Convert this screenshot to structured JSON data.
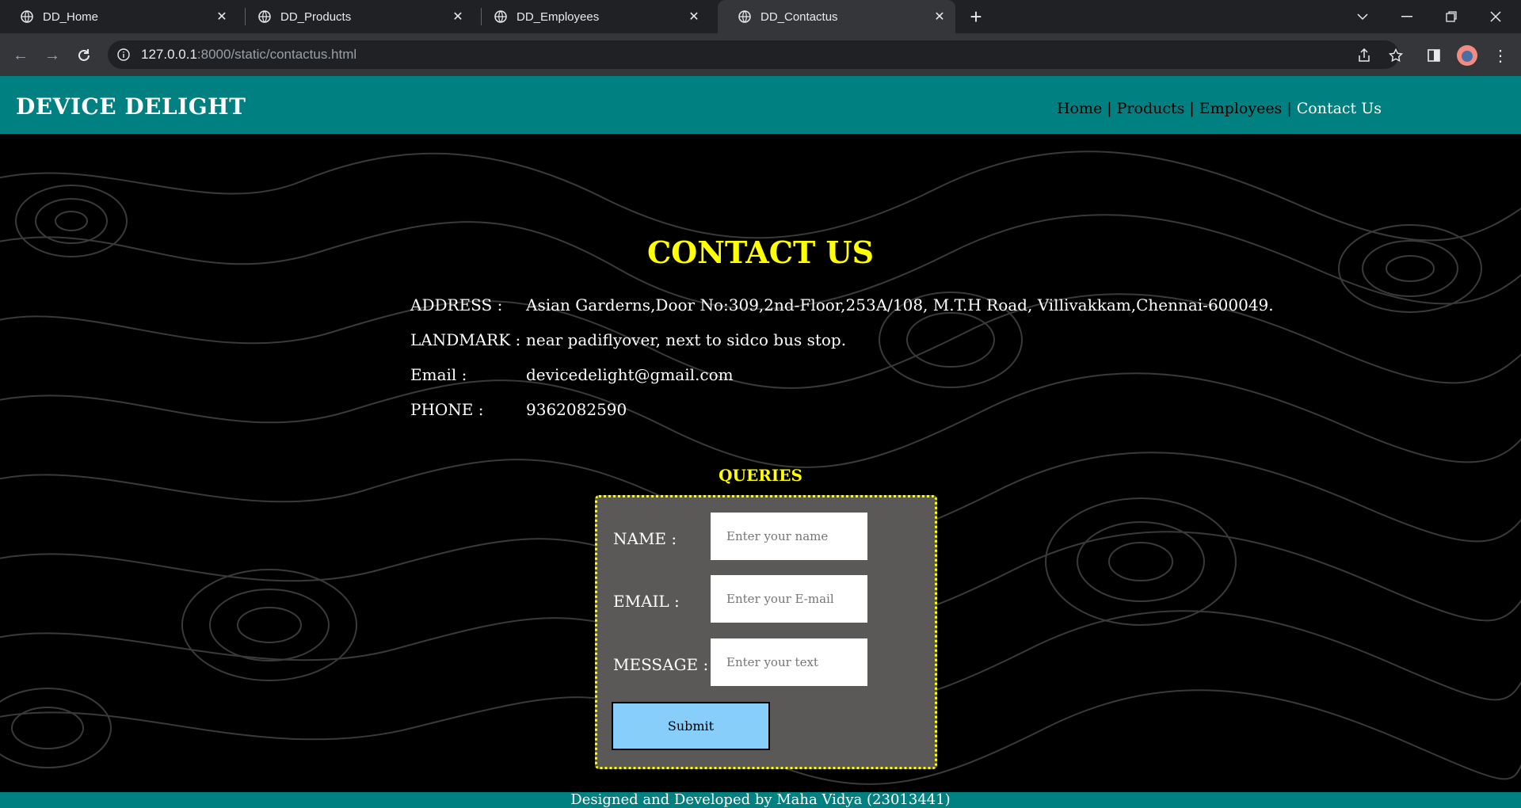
{
  "browser": {
    "tabs": [
      {
        "title": "DD_Home",
        "active": false
      },
      {
        "title": "DD_Products",
        "active": false
      },
      {
        "title": "DD_Employees",
        "active": false
      },
      {
        "title": "DD_Contactus",
        "active": true
      }
    ],
    "url_host": "127.0.0.1",
    "url_rest": ":8000/static/contactus.html"
  },
  "site": {
    "brand": "DEVICE DELIGHT",
    "nav": {
      "home": "Home",
      "products": "Products",
      "employees": "Employees",
      "contact": "Contact Us",
      "separator": "|"
    }
  },
  "contact": {
    "title": "CONTACT US",
    "rows": [
      {
        "label": "ADDRESS :",
        "value": "Asian Garderns,Door No:309,2nd-Floor,253A/108, M.T.H Road, Villivakkam,Chennai-600049."
      },
      {
        "label": "LANDMARK :",
        "value": "near padiflyover, next to sidco bus stop."
      },
      {
        "label": "Email :",
        "value": "devicedelight@gmail.com"
      },
      {
        "label": "PHONE :",
        "value": "9362082590"
      }
    ]
  },
  "form": {
    "heading": "QUERIES",
    "name_label": "NAME :",
    "name_placeholder": "Enter your name",
    "email_label": "EMAIL :",
    "email_placeholder": "Enter your E-mail",
    "message_label": "MESSAGE :",
    "message_placeholder": "Enter your text",
    "submit": "Submit"
  },
  "footer": "Designed and Developed by Maha Vidya (23013441)",
  "colors": {
    "teal": "#008080",
    "accent_yellow": "#ffff00",
    "form_bg": "#5a5957",
    "submit_bg": "#87cefa"
  }
}
